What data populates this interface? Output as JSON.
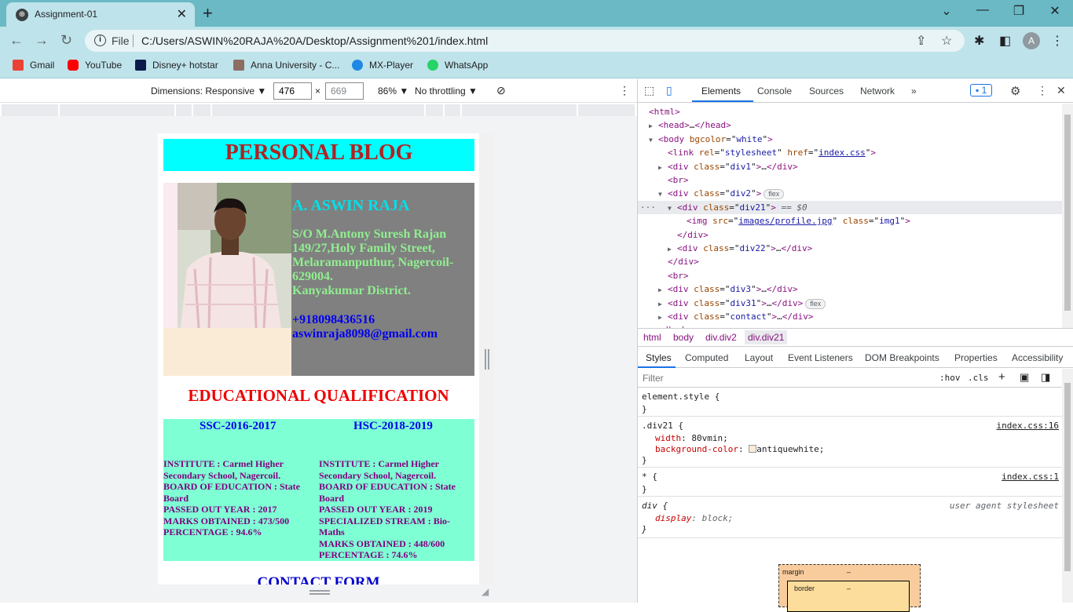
{
  "browser": {
    "tab_title": "Assignment-01",
    "tab_close": "✕",
    "new_tab": "+",
    "window_controls": [
      "⌄",
      "—",
      "❐",
      "✕"
    ],
    "nav": {
      "back": "←",
      "forward": "→",
      "reload": "↻"
    },
    "address": {
      "scheme": "File",
      "url": "C:/Users/ASWIN%20RAJA%20A/Desktop/Assignment%201/index.html"
    },
    "avatar_letter": "A",
    "bookmarks": [
      {
        "label": "Gmail",
        "icon": "gmail-icon",
        "color": "#ea4335"
      },
      {
        "label": "YouTube",
        "icon": "youtube-icon",
        "color": "#ff0000"
      },
      {
        "label": "Disney+ hotstar",
        "icon": "hotstar-icon",
        "color": "#0c1a4b"
      },
      {
        "label": "Anna University - C...",
        "icon": "anna-university-icon",
        "color": "#8d6e63"
      },
      {
        "label": "MX-Player",
        "icon": "mx-player-icon",
        "color": "#1e88e5"
      },
      {
        "label": "WhatsApp",
        "icon": "whatsapp-icon",
        "color": "#25d366"
      }
    ]
  },
  "device_toolbar": {
    "dimensions_label": "Dimensions: Responsive ▼",
    "width": "476",
    "times": "×",
    "height": "669",
    "zoom": "86% ▼",
    "throttling": "No throttling ▼"
  },
  "page": {
    "blog_title": "PERSONAL BLOG",
    "name": "A. ASWIN RAJA",
    "address_lines": [
      "S/O M.Antony Suresh Rajan",
      "149/27,Holy Family Street, Melaramanputhur, Nagercoil-629004.",
      "Kanyakumar District."
    ],
    "phone": "+918098436516",
    "email": "aswinraja8098@gmail.com",
    "edu_title": "EDUCATIONAL QUALIFICATION",
    "ssc": {
      "heading": "SSC-2016-2017",
      "lines": [
        "INSTITUTE : Carmel Higher Secondary School, Nagercoil.",
        "BOARD OF EDUCATION : State Board",
        "PASSED OUT YEAR : 2017",
        "MARKS OBTAINED : 473/500",
        "PERCENTAGE : 94.6%"
      ]
    },
    "hsc": {
      "heading": "HSC-2018-2019",
      "lines": [
        "INSTITUTE : Carmel Higher Secondary School, Nagercoil.",
        "BOARD OF EDUCATION : State Board",
        "PASSED OUT YEAR : 2019",
        "SPECIALIZED STREAM : Bio-Maths",
        "MARKS OBTAINED : 448/600",
        "PERCENTAGE : 74.6%"
      ]
    },
    "contact_title": "CONTACT FORM"
  },
  "devtools": {
    "tabs": [
      "Elements",
      "Console",
      "Sources",
      "Network",
      "»"
    ],
    "issues_count": "1",
    "dom_lines": [
      {
        "indent": 0,
        "tri": "",
        "html": "<span class='tag'>&lt;html&gt;</span>"
      },
      {
        "indent": 1,
        "tri": "▶",
        "html": "<span class='tag'>&lt;head&gt;</span>…<span class='tag'>&lt;/head&gt;</span>"
      },
      {
        "indent": 1,
        "tri": "▼",
        "html": "<span class='tag'>&lt;body</span> <span class='attr'>bgcolor</span>=\"<span class='val'>white</span>\"<span class='tag'>&gt;</span>"
      },
      {
        "indent": 2,
        "tri": "",
        "html": "<span class='tag'>&lt;link</span> <span class='attr'>rel</span>=\"<span class='val'>stylesheet</span>\" <span class='attr'>href</span>=\"<span class='link'>index.css</span>\"<span class='tag'>&gt;</span>"
      },
      {
        "indent": 2,
        "tri": "▶",
        "html": "<span class='tag'>&lt;div</span> <span class='attr'>class</span>=\"<span class='val'>div1</span>\"<span class='tag'>&gt;</span>…<span class='tag'>&lt;/div&gt;</span>"
      },
      {
        "indent": 2,
        "tri": "",
        "html": "<span class='tag'>&lt;br&gt;</span>"
      },
      {
        "indent": 2,
        "tri": "▼",
        "html": "<span class='tag'>&lt;div</span> <span class='attr'>class</span>=\"<span class='val'>div2</span>\"<span class='tag'>&gt;</span><span class='badge'>flex</span>"
      },
      {
        "indent": 3,
        "tri": "▼",
        "sel": true,
        "html": "<span class='tag'>&lt;div</span> <span class='attr'>class</span>=\"<span class='val'>div21</span>\"<span class='tag'>&gt;</span> <span style='color:#5f6368'>== <i>$0</i></span>"
      },
      {
        "indent": 4,
        "tri": "",
        "html": "<span class='tag'>&lt;img</span> <span class='attr'>src</span>=\"<span class='link'>images/profile.jpg</span>\" <span class='attr'>class</span>=\"<span class='val'>img1</span>\"<span class='tag'>&gt;</span>"
      },
      {
        "indent": 3,
        "tri": "",
        "html": "<span class='tag'>&lt;/div&gt;</span>"
      },
      {
        "indent": 3,
        "tri": "▶",
        "html": "<span class='tag'>&lt;div</span> <span class='attr'>class</span>=\"<span class='val'>div22</span>\"<span class='tag'>&gt;</span>…<span class='tag'>&lt;/div&gt;</span>"
      },
      {
        "indent": 2,
        "tri": "",
        "html": "<span class='tag'>&lt;/div&gt;</span>"
      },
      {
        "indent": 2,
        "tri": "",
        "html": "<span class='tag'>&lt;br&gt;</span>"
      },
      {
        "indent": 2,
        "tri": "▶",
        "html": "<span class='tag'>&lt;div</span> <span class='attr'>class</span>=\"<span class='val'>div3</span>\"<span class='tag'>&gt;</span>…<span class='tag'>&lt;/div&gt;</span>"
      },
      {
        "indent": 2,
        "tri": "▶",
        "html": "<span class='tag'>&lt;div</span> <span class='attr'>class</span>=\"<span class='val'>div31</span>\"<span class='tag'>&gt;</span>…<span class='tag'>&lt;/div&gt;</span><span class='badge'>flex</span>"
      },
      {
        "indent": 2,
        "tri": "▶",
        "html": "<span class='tag'>&lt;div</span> <span class='attr'>class</span>=\"<span class='val'>contact</span>\"<span class='tag'>&gt;</span>…<span class='tag'>&lt;/div&gt;</span>"
      },
      {
        "indent": 1,
        "tri": "",
        "html": "<span class='tag'>&lt;/body&gt;</span>"
      }
    ],
    "breadcrumbs": [
      "html",
      "body",
      "div.div2",
      "div.div21"
    ],
    "styles_tabs": [
      "Styles",
      "Computed",
      "Layout",
      "Event Listeners",
      "DOM Breakpoints",
      "Properties",
      "Accessibility"
    ],
    "filter_placeholder": "Filter",
    "hov": ":hov",
    "cls": ".cls",
    "rules": {
      "element_style": "element.style {",
      "div21_selector": ".div21 {",
      "div21_src": "index.css:16",
      "width_prop": "width",
      "width_val": "80vmin;",
      "bg_prop": "background-color",
      "bg_val": "antiquewhite;",
      "star_selector": "* {",
      "star_src": "index.css:1",
      "div_selector": "div {",
      "div_src": "user agent stylesheet",
      "display_prop": "display",
      "display_val": "block;",
      "close_brace": "}"
    },
    "boxmodel": {
      "margin_label": "margin",
      "margin_val": "–",
      "border_label": "border",
      "border_val": "–"
    }
  }
}
